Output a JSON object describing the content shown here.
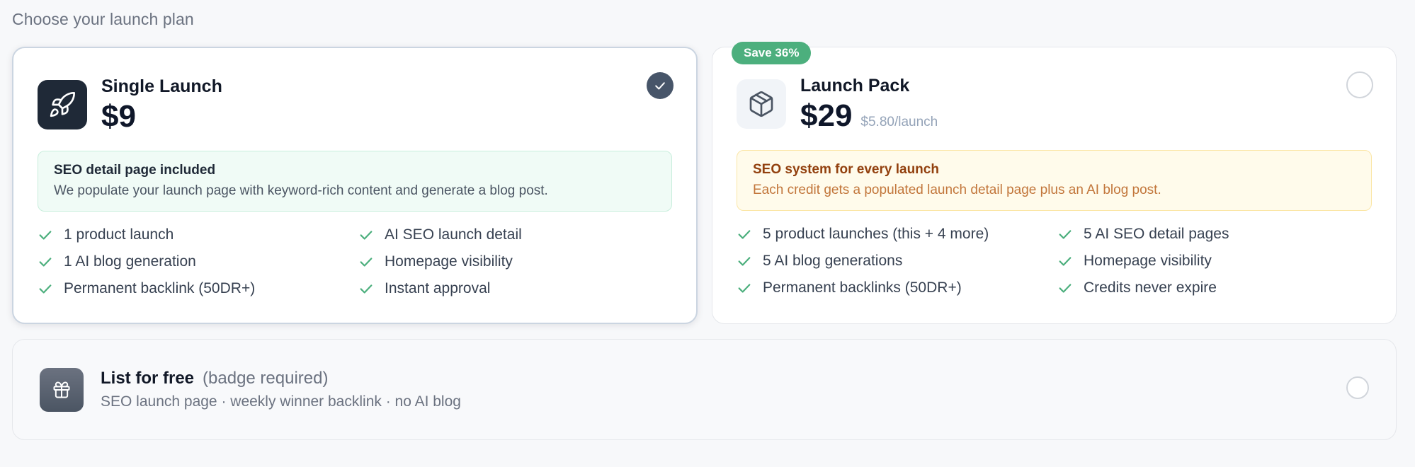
{
  "heading": "Choose your launch plan",
  "plans": [
    {
      "name": "Single Launch",
      "price": "$9",
      "sub_price": "",
      "selected": true,
      "icon": "rocket-icon",
      "info": {
        "title": "SEO detail page included",
        "text": "We populate your launch page with keyword-rich content and generate a blog post."
      },
      "features": [
        "1 product launch",
        "AI SEO launch detail",
        "1 AI blog generation",
        "Homepage visibility",
        "Permanent backlink (50DR+)",
        "Instant approval"
      ]
    },
    {
      "name": "Launch Pack",
      "price": "$29",
      "sub_price": "$5.80/launch",
      "badge": "Save 36%",
      "selected": false,
      "icon": "package-icon",
      "info": {
        "title": "SEO system for every launch",
        "text": "Each credit gets a populated launch detail page plus an AI blog post."
      },
      "features": [
        "5 product launches (this + 4 more)",
        "5 AI SEO detail pages",
        "5 AI blog generations",
        "Homepage visibility",
        "Permanent backlinks (50DR+)",
        "Credits never expire"
      ]
    }
  ],
  "free": {
    "title": "List for free",
    "note": "(badge required)",
    "description": "SEO launch page · weekly winner backlink · no AI blog",
    "icon": "gift-icon",
    "selected": false
  },
  "colors": {
    "check_green": "#4caf7d",
    "badge_green": "#4caf7d",
    "selected_indicator": "#475569",
    "dark_icon_bg": "#1f2937"
  }
}
